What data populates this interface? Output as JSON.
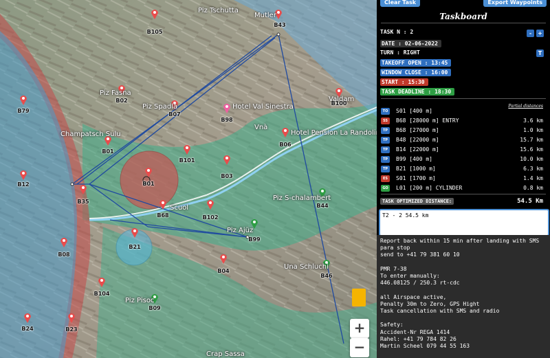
{
  "toolbar": {
    "clear_label": "Clear Task",
    "export_label": "Export Waypoints"
  },
  "taskboard": {
    "title": "Taskboard",
    "task_n": "TASK N : 2",
    "date": "DATE : 02-06-2022",
    "turn": "TURN : RIGHT",
    "takeoff": "TAKEOFF OPEN : 13:45",
    "window_close": "WINDOW CLOSE : 16:00",
    "start": "START : 15:30",
    "deadline": "TASK DEADLINE : 18:30",
    "minus": "-",
    "plus": "+",
    "t_button": "T",
    "partial_label": "Partial distances",
    "turnpoints": [
      {
        "type": "TO",
        "desc": "S01 [400 m]",
        "dist": ""
      },
      {
        "type": "SS",
        "desc": "B68 [28000 m] ENTRY",
        "dist": "3.6 km"
      },
      {
        "type": "TP",
        "desc": "B68 [27000 m]",
        "dist": "1.0 km"
      },
      {
        "type": "TP",
        "desc": "B48 [22000 m]",
        "dist": "15.7 km"
      },
      {
        "type": "TP",
        "desc": "B14 [22000 m]",
        "dist": "15.6 km"
      },
      {
        "type": "TP",
        "desc": "B99 [400 m]",
        "dist": "10.0 km"
      },
      {
        "type": "TP",
        "desc": "B21 [1000 m]",
        "dist": "6.3 km"
      },
      {
        "type": "ES",
        "desc": "S01 [1700 m]",
        "dist": "1.4 km"
      },
      {
        "type": "GO",
        "desc": "L01 [200 m] CYLINDER",
        "dist": "0.8 km"
      }
    ],
    "optimized_label": "TASK OPTIMIZED DISTANCE:",
    "optimized_value": "54.5 Km",
    "summary_value": "T2 - 2 54.5 km",
    "notes": [
      "Report back within 15 min after landing with SMS",
      "para stop",
      "send to +41 79 381 60 10",
      "",
      "PMR 7-38",
      "To enter manually:",
      "446.08125 / 250.3 rt-cdc",
      "",
      "all Airspace active,",
      "Penalty 30m to Zero, GPS Hight",
      "Task cancellation with SMS and radio",
      "",
      "Safety:",
      "Accident-Nr REGA 1414",
      "Rahel: +41 79 784 82 26",
      "Martin Scheel 079 44 55 163"
    ]
  },
  "badge_colors": {
    "TO": "#2f6fc0",
    "SS": "#c0392b",
    "TP": "#2f6fc0",
    "ES": "#c0392b",
    "GO": "#2e9e44"
  },
  "map": {
    "zoom_in": "+",
    "zoom_out": "−",
    "waypoints": [
      "B105",
      "B43",
      "B79",
      "B02",
      "B07",
      "B98",
      "B06",
      "B100",
      "B01",
      "B101",
      "B12",
      "B01",
      "B35",
      "B68",
      "B102",
      "B03",
      "B21",
      "B99",
      "B44",
      "B08",
      "B104",
      "B04",
      "B46",
      "B09",
      "B24",
      "B23"
    ],
    "places": [
      "Piz Tschutta",
      "Mutler",
      "Piz Fasna",
      "Piz Spadla",
      "Hotel Val Sinestra",
      "Hotel Pension La Randolina",
      "Valdam",
      "Champatsch Sulu",
      "Vnà",
      "Scuol",
      "Piz Ajüz",
      "Piz S-chalambert",
      "Una Schluchi",
      "Piz Pisoc",
      "Crap Sassa"
    ]
  }
}
